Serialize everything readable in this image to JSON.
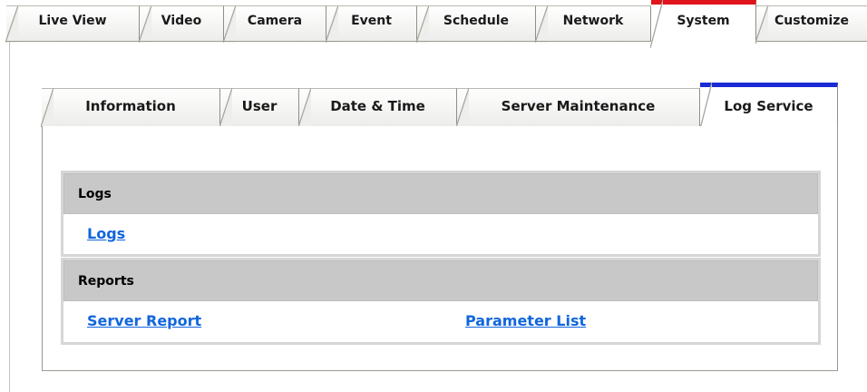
{
  "main_tabs": [
    {
      "label": "Live View",
      "active": false
    },
    {
      "label": "Video",
      "active": false
    },
    {
      "label": "Camera",
      "active": false
    },
    {
      "label": "Event",
      "active": false
    },
    {
      "label": "Schedule",
      "active": false
    },
    {
      "label": "Network",
      "active": false
    },
    {
      "label": "System",
      "active": true
    },
    {
      "label": "Customize",
      "active": false
    }
  ],
  "sub_tabs": [
    {
      "label": "Information",
      "active": false
    },
    {
      "label": "User",
      "active": false
    },
    {
      "label": "Date & Time",
      "active": false
    },
    {
      "label": "Server Maintenance",
      "active": false
    },
    {
      "label": "Log Service",
      "active": true
    }
  ],
  "sections": {
    "logs": {
      "title": "Logs",
      "links": [
        "Logs"
      ]
    },
    "reports": {
      "title": "Reports",
      "links": [
        "Server Report",
        "Parameter List"
      ]
    }
  },
  "colors": {
    "main_active_accent": "#e0141c",
    "sub_active_accent": "#1a2bd6",
    "link": "#1166dd",
    "section_header_bg": "#c8c8c8"
  }
}
